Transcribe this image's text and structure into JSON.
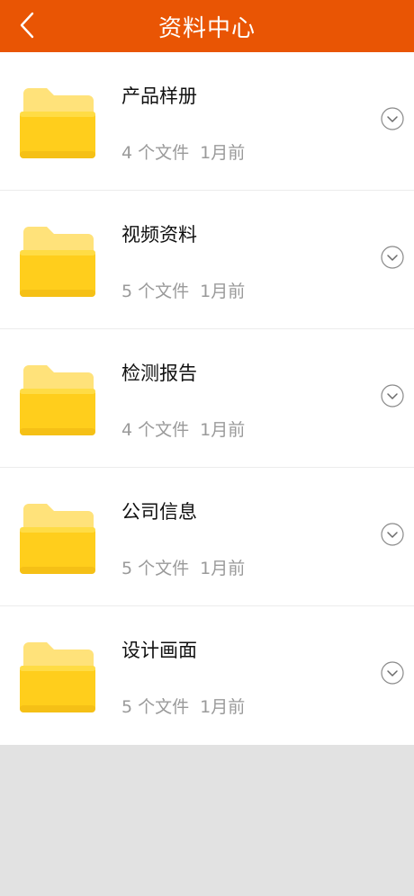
{
  "header": {
    "title": "资料中心",
    "back_icon": "chevron-left-icon"
  },
  "folders": [
    {
      "name": "产品样册",
      "file_count": "4 个文件",
      "time": "1月前"
    },
    {
      "name": "视频资料",
      "file_count": "5 个文件",
      "time": "1月前"
    },
    {
      "name": "检测报告",
      "file_count": "4 个文件",
      "time": "1月前"
    },
    {
      "name": "公司信息",
      "file_count": "5 个文件",
      "time": "1月前"
    },
    {
      "name": "设计画面",
      "file_count": "5 个文件",
      "time": "1月前"
    }
  ],
  "colors": {
    "header_bg": "#e95504",
    "folder_yellow": "#ffd21f",
    "background": "#e2e2e2"
  }
}
